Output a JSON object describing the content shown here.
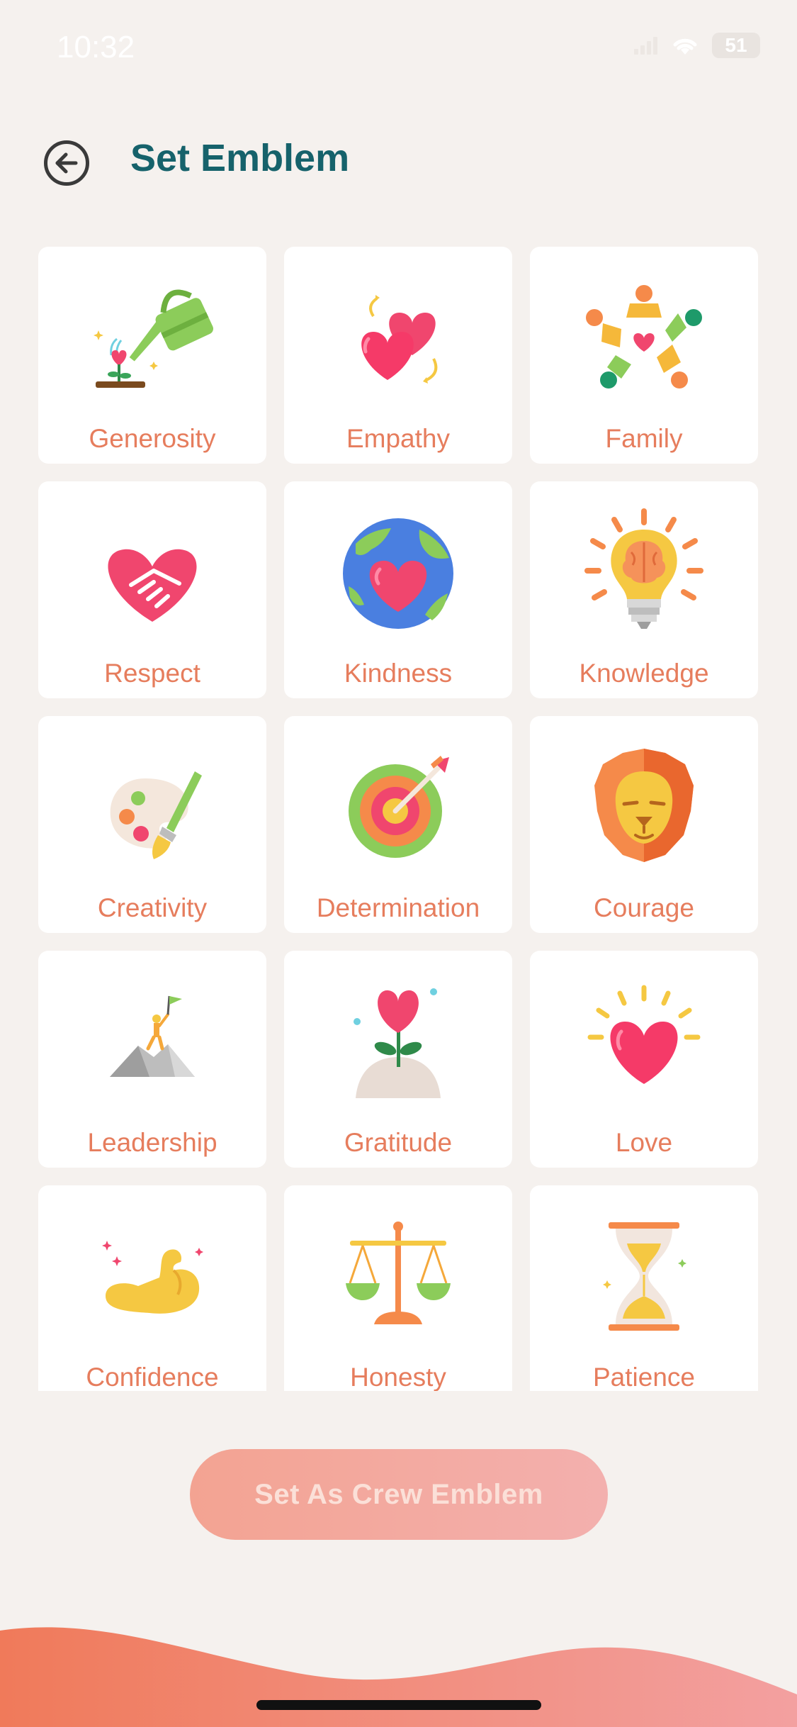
{
  "status_bar": {
    "time": "10:32",
    "battery": "51"
  },
  "header": {
    "title": "Set Emblem"
  },
  "emblems": [
    {
      "label": "Generosity",
      "icon": "watering-can-heart-icon"
    },
    {
      "label": "Empathy",
      "icon": "two-hearts-icon"
    },
    {
      "label": "Family",
      "icon": "people-circle-heart-icon"
    },
    {
      "label": "Respect",
      "icon": "heart-handshake-icon"
    },
    {
      "label": "Kindness",
      "icon": "globe-heart-icon"
    },
    {
      "label": "Knowledge",
      "icon": "lightbulb-brain-icon"
    },
    {
      "label": "Creativity",
      "icon": "palette-brush-icon"
    },
    {
      "label": "Determination",
      "icon": "target-arrow-icon"
    },
    {
      "label": "Courage",
      "icon": "lion-icon"
    },
    {
      "label": "Leadership",
      "icon": "mountain-flag-icon"
    },
    {
      "label": "Gratitude",
      "icon": "heart-plant-icon"
    },
    {
      "label": "Love",
      "icon": "shining-heart-icon"
    },
    {
      "label": "Confidence",
      "icon": "flexed-arm-icon"
    },
    {
      "label": "Honesty",
      "icon": "scales-icon"
    },
    {
      "label": "Patience",
      "icon": "hourglass-icon"
    }
  ],
  "actions": {
    "set_emblem": "Set As Crew Emblem"
  },
  "colors": {
    "background": "#f5f1ee",
    "title": "#16626b",
    "label": "#e67d5d",
    "button_start": "#f3a392",
    "button_end": "#f3b0ae",
    "wave": "#f08a70"
  }
}
